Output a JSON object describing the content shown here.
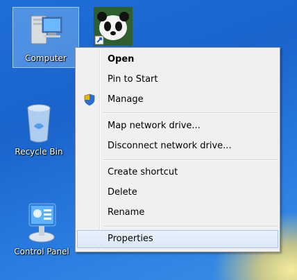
{
  "desktop": {
    "icons": [
      {
        "label": "Computer"
      },
      {
        "label": "Recycle Bin"
      },
      {
        "label": "Control Panel"
      }
    ]
  },
  "context_menu": {
    "items": [
      {
        "label": "Open",
        "bold": true
      },
      {
        "label": "Pin to Start"
      },
      {
        "label": "Manage",
        "icon": "shield-icon"
      },
      {
        "label": "Map network drive..."
      },
      {
        "label": "Disconnect network drive..."
      },
      {
        "label": "Create shortcut"
      },
      {
        "label": "Delete"
      },
      {
        "label": "Rename"
      },
      {
        "label": "Properties",
        "highlighted": true
      }
    ]
  },
  "colors": {
    "desktop_blue": "#1f6fd8",
    "menu_bg": "#f0f0f0",
    "highlight": "#dbe8f7"
  }
}
